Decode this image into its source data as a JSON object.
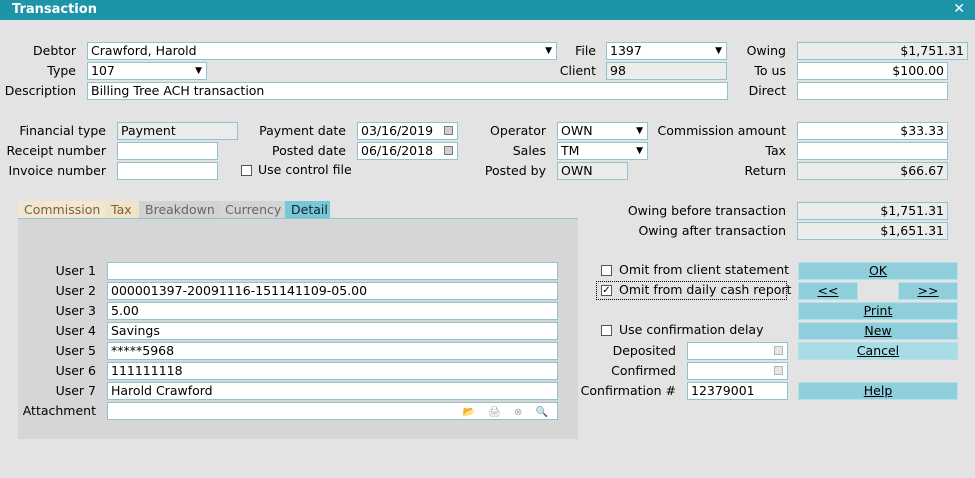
{
  "window": {
    "title": "Transaction",
    "close_glyph": "✕"
  },
  "labels": {
    "debtor": "Debtor",
    "type": "Type",
    "description": "Description",
    "file": "File",
    "client": "Client",
    "owing": "Owing",
    "to_us": "To us",
    "direct": "Direct",
    "financial_type": "Financial type",
    "receipt_number": "Receipt number",
    "invoice_number": "Invoice number",
    "payment_date": "Payment date",
    "posted_date": "Posted date",
    "use_control_file": "Use control file",
    "operator": "Operator",
    "sales": "Sales",
    "posted_by": "Posted by",
    "commission_amount": "Commission amount",
    "tax": "Tax",
    "return": "Return",
    "owing_before": "Owing before transaction",
    "owing_after": "Owing after transaction",
    "omit_client_statement": "Omit from client statement",
    "omit_daily_cash": "Omit from daily cash report",
    "use_confirmation_delay": "Use confirmation delay",
    "deposited": "Deposited",
    "confirmed": "Confirmed",
    "confirmation_no": "Confirmation #",
    "user1": "User 1",
    "user2": "User 2",
    "user3": "User 3",
    "user4": "User 4",
    "user5": "User 5",
    "user6": "User 6",
    "user7": "User 7",
    "attachment": "Attachment"
  },
  "values": {
    "debtor": "Crawford, Harold",
    "type": "107",
    "description": "Billing Tree ACH transaction",
    "file": "1397",
    "client": "98",
    "owing": "$1,751.31",
    "to_us": "$100.00",
    "direct": "",
    "financial_type": "Payment",
    "receipt_number": "",
    "invoice_number": "",
    "payment_date": "03/16/2019",
    "posted_date": "06/16/2018",
    "operator": "OWN",
    "sales": "TM",
    "posted_by": "OWN",
    "commission_amount": "$33.33",
    "tax": "",
    "return": "$66.67",
    "owing_before": "$1,751.31",
    "owing_after": "$1,651.31",
    "deposited": "",
    "confirmed": "",
    "confirmation_no": "12379001",
    "user1": "",
    "user2": "000001397-20091116-151141109-05.00",
    "user3": "5.00",
    "user4": "Savings",
    "user5": "*****5968",
    "user6": "111111118",
    "user7": "Harold Crawford",
    "attachment": ""
  },
  "checks": {
    "use_control_file": false,
    "omit_client_statement": false,
    "omit_daily_cash": true,
    "use_confirmation_delay": false,
    "checked_glyph": "✓"
  },
  "tabs": {
    "commission": "Commission",
    "tax": "Tax",
    "breakdown": "Breakdown",
    "currency": "Currency",
    "detail": "Detail",
    "active": "detail"
  },
  "buttons": {
    "ok": "OK",
    "prev": "<<",
    "next": ">>",
    "print": "Print",
    "new": "New",
    "cancel": "Cancel",
    "help": "Help"
  },
  "icons": {
    "dropdown": "▼",
    "attachment_tools": "📂 🖨 ⊗ 🔍"
  },
  "colors": {
    "titlebar": "#1e94a9",
    "button": "#8fcfdc",
    "field_border": "#8fc3cf",
    "active_tab": "#78c7d6"
  }
}
